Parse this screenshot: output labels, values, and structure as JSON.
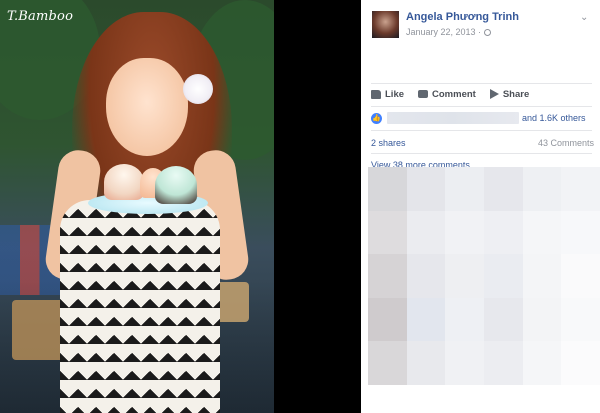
{
  "photo": {
    "watermark": "T.Bamboo"
  },
  "post": {
    "author": "Angela Phương Trinh",
    "date": "January 22, 2013 ·",
    "actions": {
      "like": "Like",
      "comment": "Comment",
      "share": "Share"
    },
    "likes_text": "and 1.6K others",
    "shares": "2 shares",
    "comments_count": "43 Comments",
    "view_more": "View 38 more comments"
  },
  "colors": {
    "link": "#365899",
    "secondary": "#90949c",
    "like_badge": "#4080ff",
    "photo_letterbox": "#000000"
  }
}
